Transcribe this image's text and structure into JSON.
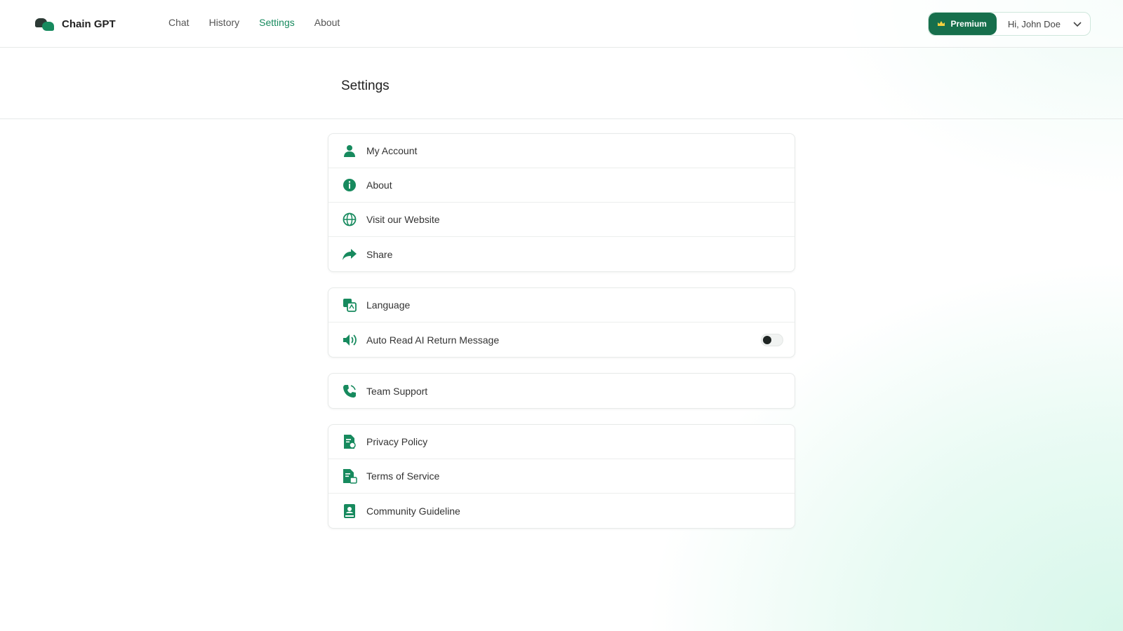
{
  "app": {
    "name": "Chain GPT"
  },
  "nav": {
    "items": [
      {
        "label": "Chat",
        "active": false
      },
      {
        "label": "History",
        "active": false
      },
      {
        "label": "Settings",
        "active": true
      },
      {
        "label": "About",
        "active": false
      }
    ]
  },
  "user": {
    "premium_label": "Premium",
    "greeting": "Hi, John Doe"
  },
  "page": {
    "title": "Settings"
  },
  "settings": {
    "group1": [
      {
        "label": "My Account",
        "icon": "user-icon"
      },
      {
        "label": "About",
        "icon": "info-icon"
      },
      {
        "label": "Visit our Website",
        "icon": "globe-icon"
      },
      {
        "label": "Share",
        "icon": "share-icon"
      }
    ],
    "group2": [
      {
        "label": "Language",
        "icon": "translate-icon"
      },
      {
        "label": "Auto Read AI Return Message",
        "icon": "speaker-icon",
        "toggle": false
      }
    ],
    "group3": [
      {
        "label": "Team Support",
        "icon": "phone-icon"
      }
    ],
    "group4": [
      {
        "label": "Privacy Policy",
        "icon": "privacy-doc-icon"
      },
      {
        "label": "Terms of Service",
        "icon": "terms-doc-icon"
      },
      {
        "label": "Community Guideline",
        "icon": "guideline-book-icon"
      }
    ]
  },
  "colors": {
    "accent": "#178a5e",
    "premium_bg": "#176f4c"
  }
}
